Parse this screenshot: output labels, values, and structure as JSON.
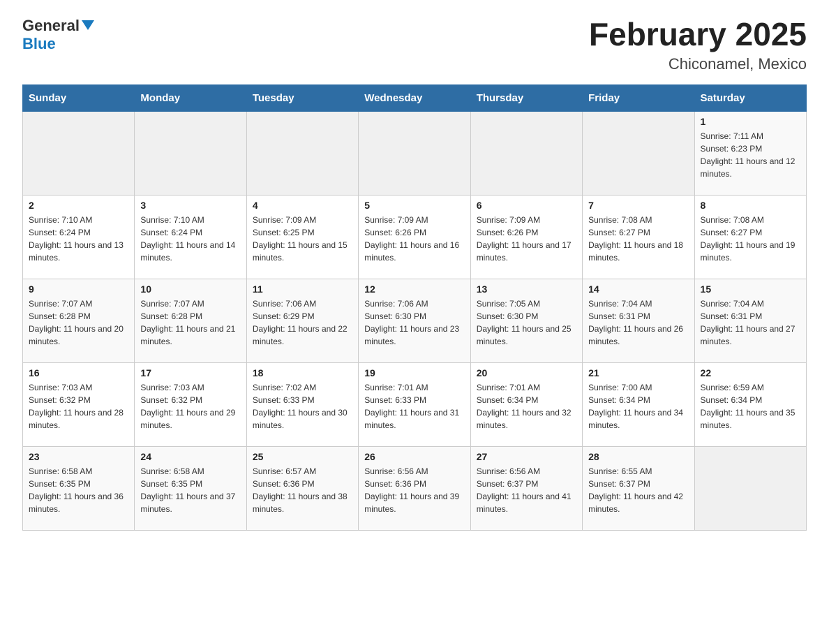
{
  "header": {
    "logo_general": "General",
    "logo_blue": "Blue",
    "main_title": "February 2025",
    "subtitle": "Chiconamel, Mexico"
  },
  "weekdays": [
    "Sunday",
    "Monday",
    "Tuesday",
    "Wednesday",
    "Thursday",
    "Friday",
    "Saturday"
  ],
  "weeks": [
    [
      {
        "day": "",
        "sunrise": "",
        "sunset": "",
        "daylight": ""
      },
      {
        "day": "",
        "sunrise": "",
        "sunset": "",
        "daylight": ""
      },
      {
        "day": "",
        "sunrise": "",
        "sunset": "",
        "daylight": ""
      },
      {
        "day": "",
        "sunrise": "",
        "sunset": "",
        "daylight": ""
      },
      {
        "day": "",
        "sunrise": "",
        "sunset": "",
        "daylight": ""
      },
      {
        "day": "",
        "sunrise": "",
        "sunset": "",
        "daylight": ""
      },
      {
        "day": "1",
        "sunrise": "Sunrise: 7:11 AM",
        "sunset": "Sunset: 6:23 PM",
        "daylight": "Daylight: 11 hours and 12 minutes."
      }
    ],
    [
      {
        "day": "2",
        "sunrise": "Sunrise: 7:10 AM",
        "sunset": "Sunset: 6:24 PM",
        "daylight": "Daylight: 11 hours and 13 minutes."
      },
      {
        "day": "3",
        "sunrise": "Sunrise: 7:10 AM",
        "sunset": "Sunset: 6:24 PM",
        "daylight": "Daylight: 11 hours and 14 minutes."
      },
      {
        "day": "4",
        "sunrise": "Sunrise: 7:09 AM",
        "sunset": "Sunset: 6:25 PM",
        "daylight": "Daylight: 11 hours and 15 minutes."
      },
      {
        "day": "5",
        "sunrise": "Sunrise: 7:09 AM",
        "sunset": "Sunset: 6:26 PM",
        "daylight": "Daylight: 11 hours and 16 minutes."
      },
      {
        "day": "6",
        "sunrise": "Sunrise: 7:09 AM",
        "sunset": "Sunset: 6:26 PM",
        "daylight": "Daylight: 11 hours and 17 minutes."
      },
      {
        "day": "7",
        "sunrise": "Sunrise: 7:08 AM",
        "sunset": "Sunset: 6:27 PM",
        "daylight": "Daylight: 11 hours and 18 minutes."
      },
      {
        "day": "8",
        "sunrise": "Sunrise: 7:08 AM",
        "sunset": "Sunset: 6:27 PM",
        "daylight": "Daylight: 11 hours and 19 minutes."
      }
    ],
    [
      {
        "day": "9",
        "sunrise": "Sunrise: 7:07 AM",
        "sunset": "Sunset: 6:28 PM",
        "daylight": "Daylight: 11 hours and 20 minutes."
      },
      {
        "day": "10",
        "sunrise": "Sunrise: 7:07 AM",
        "sunset": "Sunset: 6:28 PM",
        "daylight": "Daylight: 11 hours and 21 minutes."
      },
      {
        "day": "11",
        "sunrise": "Sunrise: 7:06 AM",
        "sunset": "Sunset: 6:29 PM",
        "daylight": "Daylight: 11 hours and 22 minutes."
      },
      {
        "day": "12",
        "sunrise": "Sunrise: 7:06 AM",
        "sunset": "Sunset: 6:30 PM",
        "daylight": "Daylight: 11 hours and 23 minutes."
      },
      {
        "day": "13",
        "sunrise": "Sunrise: 7:05 AM",
        "sunset": "Sunset: 6:30 PM",
        "daylight": "Daylight: 11 hours and 25 minutes."
      },
      {
        "day": "14",
        "sunrise": "Sunrise: 7:04 AM",
        "sunset": "Sunset: 6:31 PM",
        "daylight": "Daylight: 11 hours and 26 minutes."
      },
      {
        "day": "15",
        "sunrise": "Sunrise: 7:04 AM",
        "sunset": "Sunset: 6:31 PM",
        "daylight": "Daylight: 11 hours and 27 minutes."
      }
    ],
    [
      {
        "day": "16",
        "sunrise": "Sunrise: 7:03 AM",
        "sunset": "Sunset: 6:32 PM",
        "daylight": "Daylight: 11 hours and 28 minutes."
      },
      {
        "day": "17",
        "sunrise": "Sunrise: 7:03 AM",
        "sunset": "Sunset: 6:32 PM",
        "daylight": "Daylight: 11 hours and 29 minutes."
      },
      {
        "day": "18",
        "sunrise": "Sunrise: 7:02 AM",
        "sunset": "Sunset: 6:33 PM",
        "daylight": "Daylight: 11 hours and 30 minutes."
      },
      {
        "day": "19",
        "sunrise": "Sunrise: 7:01 AM",
        "sunset": "Sunset: 6:33 PM",
        "daylight": "Daylight: 11 hours and 31 minutes."
      },
      {
        "day": "20",
        "sunrise": "Sunrise: 7:01 AM",
        "sunset": "Sunset: 6:34 PM",
        "daylight": "Daylight: 11 hours and 32 minutes."
      },
      {
        "day": "21",
        "sunrise": "Sunrise: 7:00 AM",
        "sunset": "Sunset: 6:34 PM",
        "daylight": "Daylight: 11 hours and 34 minutes."
      },
      {
        "day": "22",
        "sunrise": "Sunrise: 6:59 AM",
        "sunset": "Sunset: 6:34 PM",
        "daylight": "Daylight: 11 hours and 35 minutes."
      }
    ],
    [
      {
        "day": "23",
        "sunrise": "Sunrise: 6:58 AM",
        "sunset": "Sunset: 6:35 PM",
        "daylight": "Daylight: 11 hours and 36 minutes."
      },
      {
        "day": "24",
        "sunrise": "Sunrise: 6:58 AM",
        "sunset": "Sunset: 6:35 PM",
        "daylight": "Daylight: 11 hours and 37 minutes."
      },
      {
        "day": "25",
        "sunrise": "Sunrise: 6:57 AM",
        "sunset": "Sunset: 6:36 PM",
        "daylight": "Daylight: 11 hours and 38 minutes."
      },
      {
        "day": "26",
        "sunrise": "Sunrise: 6:56 AM",
        "sunset": "Sunset: 6:36 PM",
        "daylight": "Daylight: 11 hours and 39 minutes."
      },
      {
        "day": "27",
        "sunrise": "Sunrise: 6:56 AM",
        "sunset": "Sunset: 6:37 PM",
        "daylight": "Daylight: 11 hours and 41 minutes."
      },
      {
        "day": "28",
        "sunrise": "Sunrise: 6:55 AM",
        "sunset": "Sunset: 6:37 PM",
        "daylight": "Daylight: 11 hours and 42 minutes."
      },
      {
        "day": "",
        "sunrise": "",
        "sunset": "",
        "daylight": ""
      }
    ]
  ]
}
